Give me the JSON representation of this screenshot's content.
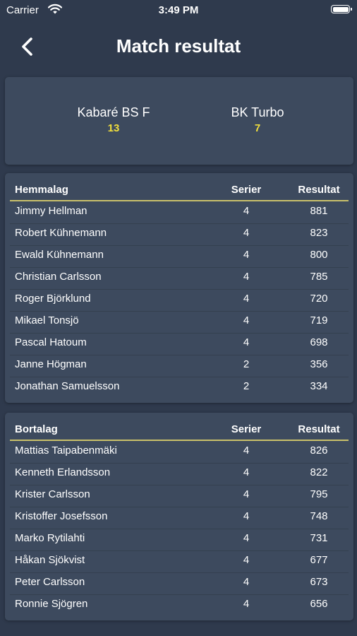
{
  "status": {
    "carrier": "Carrier",
    "time": "3:49 PM"
  },
  "nav": {
    "title": "Match resultat"
  },
  "match": {
    "home": {
      "name": "Kabaré BS F",
      "score": "13"
    },
    "away": {
      "name": "BK Turbo",
      "score": "7"
    }
  },
  "home_table": {
    "headers": {
      "name": "Hemmalag",
      "series": "Serier",
      "result": "Resultat"
    },
    "rows": [
      {
        "name": "Jimmy Hellman",
        "series": "4",
        "result": "881"
      },
      {
        "name": "Robert Kühnemann",
        "series": "4",
        "result": "823"
      },
      {
        "name": "Ewald Kühnemann",
        "series": "4",
        "result": "800"
      },
      {
        "name": "Christian Carlsson",
        "series": "4",
        "result": "785"
      },
      {
        "name": "Roger Björklund",
        "series": "4",
        "result": "720"
      },
      {
        "name": "Mikael Tonsjö",
        "series": "4",
        "result": "719"
      },
      {
        "name": "Pascal Hatoum",
        "series": "4",
        "result": "698"
      },
      {
        "name": "Janne Högman",
        "series": "2",
        "result": "356"
      },
      {
        "name": "Jonathan Samuelsson",
        "series": "2",
        "result": "334"
      }
    ]
  },
  "away_table": {
    "headers": {
      "name": "Bortalag",
      "series": "Serier",
      "result": "Resultat"
    },
    "rows": [
      {
        "name": "Mattias Taipabenmäki",
        "series": "4",
        "result": "826"
      },
      {
        "name": "Kenneth Erlandsson",
        "series": "4",
        "result": "822"
      },
      {
        "name": "Krister Carlsson",
        "series": "4",
        "result": "795"
      },
      {
        "name": "Kristoffer Josefsson",
        "series": "4",
        "result": "748"
      },
      {
        "name": "Marko Rytilahti",
        "series": "4",
        "result": "731"
      },
      {
        "name": "Håkan Sjökvist",
        "series": "4",
        "result": "677"
      },
      {
        "name": "Peter Carlsson",
        "series": "4",
        "result": "673"
      },
      {
        "name": "Ronnie Sjögren",
        "series": "4",
        "result": "656"
      }
    ]
  },
  "colors": {
    "background": "#2f3a4d",
    "card": "#3d4a5e",
    "score": "#f2df3c",
    "header_rule": "#c9c06a"
  },
  "icons": {
    "back": "chevron-left-icon",
    "wifi": "wifi-icon",
    "battery": "battery-icon"
  }
}
